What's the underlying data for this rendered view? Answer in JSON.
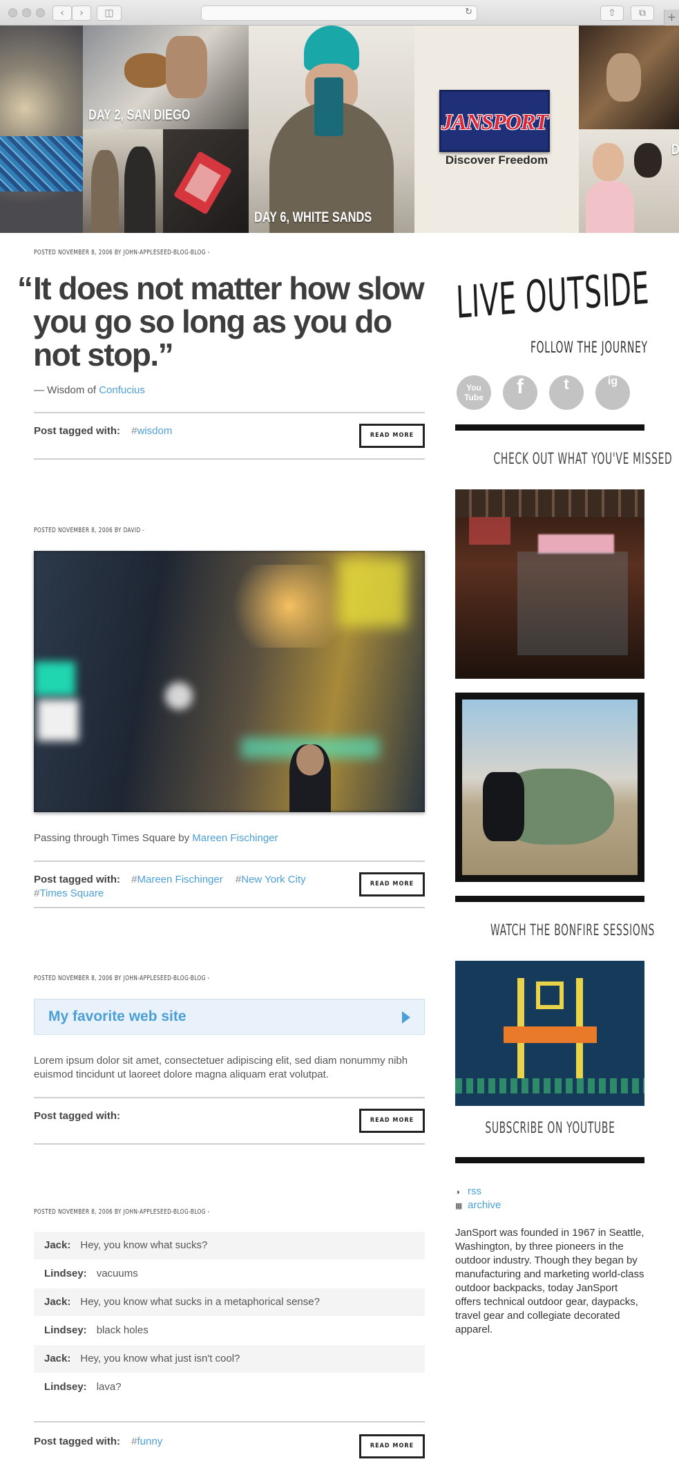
{
  "banner": {
    "captions": [
      "DAY 2, SAN DIEGO",
      "DAY 6, WHITE SANDS",
      "D"
    ],
    "brand": "JANSPORT",
    "brand_tagline": "Discover Freedom"
  },
  "posts": [
    {
      "meta": "POSTED NOVEMBER 8, 2006 BY JOHN-APPLESEED-BLOG-BLOG -",
      "quote_open": "“",
      "quote": "It does not matter how slow you go so long as you do not stop.”",
      "attribution_prefix": "— Wisdom of ",
      "attribution_link": "Confucius",
      "tagged_label": "Post tagged with:",
      "tags": [
        "wisdom"
      ],
      "read_more": "READ MORE"
    },
    {
      "meta": "POSTED NOVEMBER 8, 2006 BY DAVID -",
      "caption_prefix": "Passing through Times Square by ",
      "caption_link": "Mareen Fischinger",
      "tagged_label": "Post tagged with:",
      "tags": [
        "Mareen Fischinger",
        "New York City",
        "Times Square"
      ],
      "read_more": "READ MORE"
    },
    {
      "meta": "POSTED NOVEMBER 8, 2006 BY JOHN-APPLESEED-BLOG-BLOG -",
      "link_title": "My favorite web site",
      "body": "Lorem ipsum dolor sit amet, consectetuer adipiscing elit, sed diam nonummy nibh euismod tincidunt ut laoreet dolore magna aliquam erat volutpat.",
      "tagged_label": "Post tagged with:",
      "read_more": "READ MORE"
    },
    {
      "meta": "POSTED NOVEMBER 8, 2006 BY JOHN-APPLESEED-BLOG-BLOG -",
      "chat": [
        {
          "speaker": "Jack:",
          "line": "Hey, you know what sucks?"
        },
        {
          "speaker": "Lindsey:",
          "line": "vacuums"
        },
        {
          "speaker": "Jack:",
          "line": "Hey, you know what sucks in a metaphorical sense?"
        },
        {
          "speaker": "Lindsey:",
          "line": "black holes"
        },
        {
          "speaker": "Jack:",
          "line": "Hey, you know what just isn't cool?"
        },
        {
          "speaker": "Lindsey:",
          "line": "lava?"
        }
      ],
      "tagged_label": "Post tagged with:",
      "tags": [
        "funny"
      ],
      "read_more": "READ MORE"
    }
  ],
  "sidebar": {
    "live_outside": "LIVE OUTSIDE",
    "follow": "FOLLOW THE JOURNEY",
    "social": [
      "You Tube",
      "f",
      "t",
      "ig"
    ],
    "missed_heading": "CHECK OUT WHAT YOU'VE MISSED",
    "bonfire_heading": "WATCH THE BONFIRE SESSIONS",
    "subscribe": "SUBSCRIBE ON YOUTUBE",
    "links": [
      {
        "icon": "rss-icon",
        "label": "rss"
      },
      {
        "icon": "archive-icon",
        "label": "archive"
      }
    ],
    "about": "JanSport was founded in 1967 in Seattle, Washington, by three pioneers in the outdoor industry. Though they began by manufacturing and marketing world-class outdoor backpacks, today JanSport offers technical outdoor gear, daypacks, travel gear and collegiate decorated apparel."
  },
  "colors": {
    "link": "#4b9fd5",
    "text": "#444444",
    "bar": "#111111"
  }
}
